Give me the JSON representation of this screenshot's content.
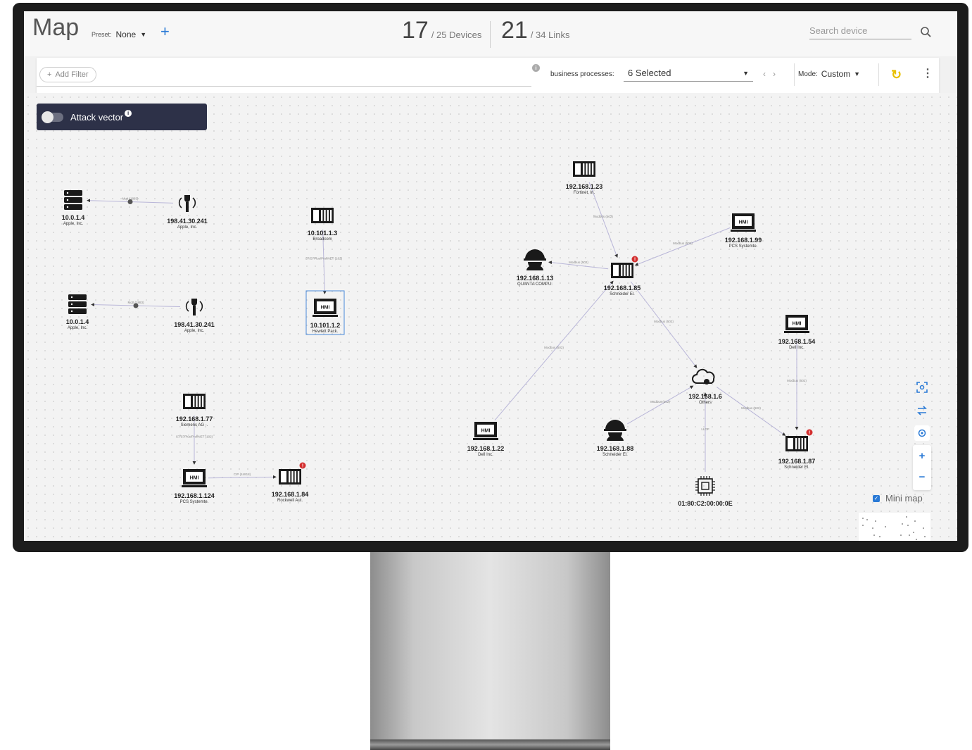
{
  "header": {
    "title": "Map",
    "preset_label": "Preset:",
    "preset_value": "None",
    "devices_count": "17",
    "devices_total": "/ 25 Devices",
    "links_count": "21",
    "links_total": "/ 34 Links",
    "search_placeholder": "Search device"
  },
  "filterbar": {
    "add_filter": "Add Filter",
    "bp_label": "business processes:",
    "bp_value": "6 Selected",
    "mode_label": "Mode:",
    "mode_value": "Custom"
  },
  "attack_vector": {
    "label": "Attack vector",
    "enabled": false
  },
  "minimap": {
    "label": "Mini map",
    "checked": true
  },
  "nodes": [
    {
      "id": "n1",
      "icon": "server",
      "ip": "10.0.1.4",
      "vendor": "Apple, Inc.",
      "alert": false
    },
    {
      "id": "n2",
      "icon": "sensor",
      "ip": "198.41.30.241",
      "vendor": "Apple, Inc.",
      "alert": false
    },
    {
      "id": "n3",
      "icon": "server",
      "ip": "10.0.1.4",
      "vendor": "Apple, Inc.",
      "alert": false
    },
    {
      "id": "n4",
      "icon": "sensor",
      "ip": "198.41.30.241",
      "vendor": "Apple, Inc.",
      "alert": false
    },
    {
      "id": "n5",
      "icon": "plc",
      "ip": "10.101.1.3",
      "vendor": "Broadcom",
      "alert": false
    },
    {
      "id": "n6",
      "icon": "hmi",
      "ip": "10.101.1.2",
      "vendor": "Hewlett Pack.",
      "alert": false
    },
    {
      "id": "n7",
      "icon": "plc",
      "ip": "192.168.1.77",
      "vendor": "Siemens AG -.",
      "alert": false
    },
    {
      "id": "n8",
      "icon": "hmi",
      "ip": "192.168.1.124",
      "vendor": "PCS Systemte.",
      "alert": false
    },
    {
      "id": "n9",
      "icon": "plc",
      "ip": "192.168.1.84",
      "vendor": "Rockwell Aut.",
      "alert": true
    },
    {
      "id": "n10",
      "icon": "plc",
      "ip": "192.168.1.23",
      "vendor": "Fortinet, In.",
      "alert": false
    },
    {
      "id": "n11",
      "icon": "hmi",
      "ip": "192.168.1.99",
      "vendor": "PCS Systemte.",
      "alert": false
    },
    {
      "id": "n12",
      "icon": "worker",
      "ip": "192.168.1.13",
      "vendor": "QUANTA COMPU.",
      "alert": false
    },
    {
      "id": "n13",
      "icon": "plc",
      "ip": "192.168.1.85",
      "vendor": "Schneider El.",
      "alert": true
    },
    {
      "id": "n14",
      "icon": "hmi",
      "ip": "192.168.1.54",
      "vendor": "Dell Inc.",
      "alert": false
    },
    {
      "id": "n15",
      "icon": "cloud",
      "ip": "192.168.1.6",
      "vendor": "Others",
      "alert": false
    },
    {
      "id": "n16",
      "icon": "hmi",
      "ip": "192.168.1.22",
      "vendor": "Dell Inc.",
      "alert": false
    },
    {
      "id": "n17",
      "icon": "worker",
      "ip": "192.168.1.88",
      "vendor": "Schneider El.",
      "alert": false
    },
    {
      "id": "n18",
      "icon": "plc",
      "ip": "192.168.1.87",
      "vendor": "Schneider El.",
      "alert": true
    },
    {
      "id": "n19",
      "icon": "chip",
      "ip": "01:80:C2:00:00:0E",
      "vendor": "",
      "alert": false
    }
  ],
  "edges": [
    {
      "from": "n2",
      "to": "n1",
      "label": "Mqtt (1883)"
    },
    {
      "from": "n4",
      "to": "n3",
      "label": "Mqtt (1883)"
    },
    {
      "from": "n5",
      "to": "n6",
      "label": "S7/S7Plus/ProfiNET (102)"
    },
    {
      "from": "n7",
      "to": "n8",
      "label": "S7/S7Plus/ProfiNET (102)"
    },
    {
      "from": "n8",
      "to": "n9",
      "label": "CIP (44818)"
    },
    {
      "from": "n10",
      "to": "n13",
      "label": "Modbus (502)"
    },
    {
      "from": "n11",
      "to": "n13",
      "label": "Modbus (502)"
    },
    {
      "from": "n13",
      "to": "n12",
      "label": "Modbus (502)"
    },
    {
      "from": "n13",
      "to": "n15",
      "label": "Modbus (502)"
    },
    {
      "from": "n16",
      "to": "n13",
      "label": "Modbus (502)"
    },
    {
      "from": "n17",
      "to": "n15",
      "label": "Modbus (502)"
    },
    {
      "from": "n15",
      "to": "n18",
      "label": "Modbus (502)"
    },
    {
      "from": "n14",
      "to": "n18",
      "label": "Modbus (502)"
    },
    {
      "from": "n19",
      "to": "n15",
      "label": "LLDP"
    }
  ]
}
